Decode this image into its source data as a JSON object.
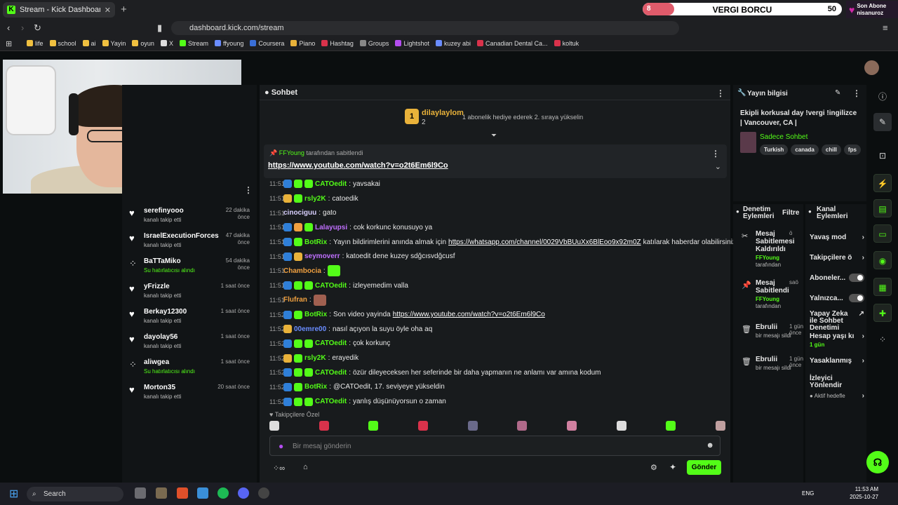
{
  "browser": {
    "tab_title": "Stream - Kick Dashboard",
    "tab_close": "✕",
    "new_tab": "+",
    "url": "dashboard.kick.com/stream",
    "bookmarks": [
      "life",
      "school",
      "ai",
      "Yayin",
      "oyun",
      "X",
      "Stream",
      "ffyoung",
      "Coursera",
      "Piano",
      "Hashtag",
      "Groups",
      "Lightshot",
      "kuzey abi",
      "Canadian Dental Ca...",
      "koltuk"
    ]
  },
  "overlay": {
    "goal_label": "VERGI BORCU",
    "goal_current": "8",
    "goal_target": "50",
    "goal_fraction": 0.16,
    "last_sub_title": "Son Abone",
    "last_sub_name": "nisanuroz"
  },
  "activity": {
    "items": [
      {
        "name": "serefinyooo",
        "sub": "kanalı takip etti",
        "time": "22 dakika önce",
        "type": "follow"
      },
      {
        "name": "IsraelExecutionForces",
        "sub": "kanalı takip etti",
        "time": "47 dakika önce",
        "type": "follow"
      },
      {
        "name": "BaTTaMiko",
        "sub": "Su hatırlatıcısı alındı",
        "time": "54 dakika önce",
        "type": "reward"
      },
      {
        "name": "yFrizzle",
        "sub": "kanalı takip etti",
        "time": "1 saat önce",
        "type": "follow"
      },
      {
        "name": "Berkay12300",
        "sub": "kanalı takip etti",
        "time": "1 saat önce",
        "type": "follow"
      },
      {
        "name": "dayolay56",
        "sub": "kanalı takip etti",
        "time": "1 saat önce",
        "type": "follow"
      },
      {
        "name": "aliwgea",
        "sub": "Su hatırlatıcısı alındı",
        "time": "1 saat önce",
        "type": "reward"
      },
      {
        "name": "Morton35",
        "sub": "kanalı takip etti",
        "time": "20 saat önce",
        "type": "follow"
      }
    ]
  },
  "chat": {
    "title": "Sohbet",
    "gifter_rank": "1",
    "gifter_name": "dilaylaylom",
    "gifter_count": "2",
    "gifter_desc": "1 abonelik hediye ederek 2. sıraya yükselin",
    "pinned_by_user": "FFYoung",
    "pinned_by_suffix": "tarafından sabitlendi",
    "pinned_link": "https://www.youtube.com/watch?v=o2t6Em6l9Co",
    "messages": [
      {
        "time": "11:51",
        "user": "CATOedit",
        "color": "#53fc18",
        "text": "yavsakai",
        "badges": [
          "#2f7fd8",
          "#53fc18",
          "#53fc18"
        ]
      },
      {
        "time": "11:51",
        "user": "rsly2K",
        "color": "#53fc18",
        "text": "catoedik",
        "badges": [
          "#e9b23a",
          "#53fc18"
        ]
      },
      {
        "time": "11:51",
        "user": "cinociguu",
        "color": "#d9d0ff",
        "text": "gato",
        "badges": []
      },
      {
        "time": "11:51",
        "user": "Lalayupsi",
        "color": "#c070ff",
        "text": "cok korkunc konusuyo ya",
        "badges": [
          "#2f7fd8",
          "#f0a040",
          "#53fc18"
        ]
      },
      {
        "time": "11:51",
        "user": "BotRix",
        "color": "#53fc18",
        "text": "Yayın bildirimlerini anında almak için",
        "link": "https://whatsapp.com/channel/0029VbBUuXx6BlEoo9x92m0Z",
        "text2": "katılarak haberdar olabilirsiniz",
        "badges": [
          "#2f7fd8",
          "#53fc18"
        ]
      },
      {
        "time": "11:51",
        "user": "seymoverr",
        "color": "#c070ff",
        "text": "katoedit dene kuzey sdğcısvdğcusf",
        "badges": [
          "#2f7fd8",
          "#e9b23a"
        ]
      },
      {
        "time": "11:51",
        "user": "Chambocia",
        "color": "#f0a040",
        "text": "",
        "badges": [],
        "emote": "#53fc18"
      },
      {
        "time": "11:51",
        "user": "CATOedit",
        "color": "#53fc18",
        "text": "izleyemedim valla",
        "badges": [
          "#2f7fd8",
          "#53fc18",
          "#53fc18"
        ]
      },
      {
        "time": "11:51",
        "user": "Flufran",
        "color": "#f0a040",
        "text": "",
        "badges": [],
        "emote": "#a06050"
      },
      {
        "time": "11:52",
        "user": "BotRix",
        "color": "#53fc18",
        "text": "Son video yayinda",
        "link": "https://www.youtube.com/watch?v=o2t6Em6l9Co",
        "text2": "",
        "badges": [
          "#2f7fd8",
          "#53fc18"
        ]
      },
      {
        "time": "11:52",
        "user": "00emre00",
        "color": "#6a8cff",
        "text": "nasıl açıyon la suyu öyle oha aq",
        "badges": [
          "#e9b23a"
        ]
      },
      {
        "time": "11:52",
        "user": "CATOedit",
        "color": "#53fc18",
        "text": "çok korkunç",
        "badges": [
          "#2f7fd8",
          "#53fc18",
          "#53fc18"
        ]
      },
      {
        "time": "11:52",
        "user": "rsly2K",
        "color": "#53fc18",
        "text": "erayedik",
        "badges": [
          "#e9b23a",
          "#53fc18"
        ]
      },
      {
        "time": "11:52",
        "user": "CATOedit",
        "color": "#53fc18",
        "text": "özür dileyeceksen her seferinde bir daha yapmanın ne anlamı var amına kodum",
        "badges": [
          "#2f7fd8",
          "#53fc18",
          "#53fc18"
        ]
      },
      {
        "time": "11:52",
        "user": "BotRix",
        "color": "#53fc18",
        "text": "@CATOedit, 17. seviyeye yükseldin",
        "badges": [
          "#2f7fd8",
          "#53fc18"
        ]
      },
      {
        "time": "11:52",
        "user": "CATOedit",
        "color": "#53fc18",
        "text": "yanlış düşünüyorsun o zaman",
        "badges": [
          "#2f7fd8",
          "#53fc18",
          "#53fc18"
        ]
      }
    ],
    "sub_only_label": "Takipçilere Özel",
    "input_placeholder": "Bir mesaj gönderin",
    "send_label": "Gönder"
  },
  "stream_info": {
    "title": "Yayın bilgisi",
    "stream_title": "Ekipli korkusal day !vergi !ingilizce | Vancouver, CA |",
    "category": "Sadece Sohbet",
    "tags": [
      "Turkish",
      "canada",
      "chill",
      "fps"
    ]
  },
  "mod_actions": {
    "title": "Denetim Eylemleri",
    "filter": "Filtre",
    "items": [
      {
        "action": "Mesaj Sabitlemesi Kaldırıldı",
        "user": "FFYoung",
        "sub": "tarafından",
        "time": "ö"
      },
      {
        "action": "Mesaj Sabitlendi",
        "user": "FFYoung",
        "sub": "tarafından",
        "time": "saö"
      },
      {
        "action": "Ebrulii",
        "user": "",
        "sub": "bir mesajı sildi",
        "time": "1 gün önce"
      },
      {
        "action": "Ebrulii",
        "user": "",
        "sub": "bir mesajı sildi",
        "time": "1 gün önce"
      }
    ]
  },
  "channel_actions": {
    "title": "Kanal Eylemleri",
    "items": [
      "Yavaş mod",
      "Takipçilere ö",
      "Aboneler...",
      "Yalnızca...",
      "Yapay Zeka ile Sohbet Denetimi",
      "Hesap yaşı kı",
      "Yasaklanmış",
      "İzleyici Yönlendir",
      "Aktif hedefle"
    ],
    "hesap_sub": "1 gün"
  },
  "taskbar": {
    "search": "Search",
    "lang": "ENG",
    "time": "11:53 AM",
    "date": "2025-10-27"
  }
}
